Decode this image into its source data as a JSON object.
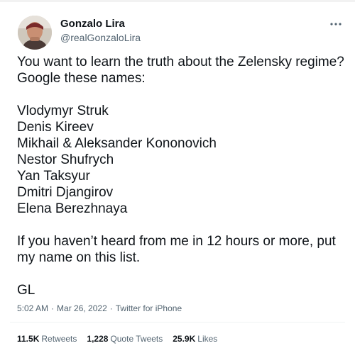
{
  "author": {
    "name": "Gonzalo Lira",
    "handle": "@realGonzaloLira"
  },
  "tweet": {
    "lines": [
      "You want to learn the truth about the Zelensky regime?",
      "Google these names:",
      "",
      "Vlodymyr Struk",
      "Denis Kireev",
      "Mikhail & Aleksander Kononovich",
      "Nestor Shufrych",
      "Yan Taksyur",
      "Dmitri Djangirov",
      "Elena Berezhnaya",
      "",
      "If you haven’t heard from me in 12 hours or more, put",
      "my name on this list.",
      "",
      "GL"
    ]
  },
  "meta": {
    "time": "5:02 AM",
    "separator": "·",
    "date": "Mar 26, 2022",
    "client": "Twitter for iPhone"
  },
  "stats": {
    "retweets_count": "11.5K",
    "retweets_label": "Retweets",
    "quotes_count": "1,228",
    "quotes_label": "Quote Tweets",
    "likes_count": "25.9K",
    "likes_label": "Likes"
  },
  "icons": {
    "more": "more-horizontal-icon"
  },
  "colors": {
    "text": "#0f1419",
    "secondary": "#536471",
    "divider": "#eff3f4"
  }
}
